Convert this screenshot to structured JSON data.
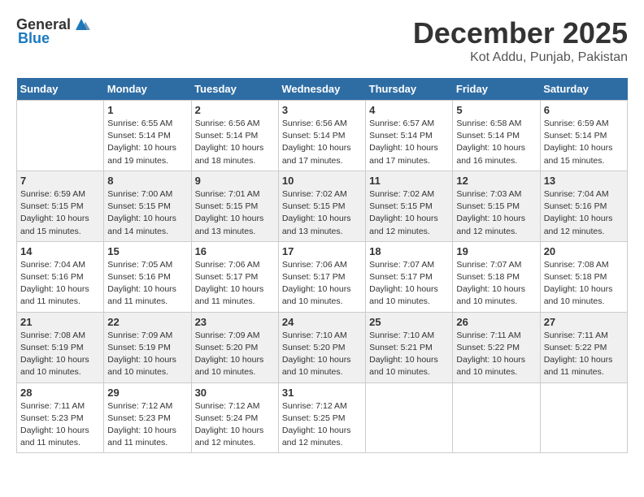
{
  "logo": {
    "general": "General",
    "blue": "Blue"
  },
  "title": {
    "month_year": "December 2025",
    "location": "Kot Addu, Punjab, Pakistan"
  },
  "weekdays": [
    "Sunday",
    "Monday",
    "Tuesday",
    "Wednesday",
    "Thursday",
    "Friday",
    "Saturday"
  ],
  "weeks": [
    [
      {
        "day": "",
        "info": ""
      },
      {
        "day": "1",
        "info": "Sunrise: 6:55 AM\nSunset: 5:14 PM\nDaylight: 10 hours\nand 19 minutes."
      },
      {
        "day": "2",
        "info": "Sunrise: 6:56 AM\nSunset: 5:14 PM\nDaylight: 10 hours\nand 18 minutes."
      },
      {
        "day": "3",
        "info": "Sunrise: 6:56 AM\nSunset: 5:14 PM\nDaylight: 10 hours\nand 17 minutes."
      },
      {
        "day": "4",
        "info": "Sunrise: 6:57 AM\nSunset: 5:14 PM\nDaylight: 10 hours\nand 17 minutes."
      },
      {
        "day": "5",
        "info": "Sunrise: 6:58 AM\nSunset: 5:14 PM\nDaylight: 10 hours\nand 16 minutes."
      },
      {
        "day": "6",
        "info": "Sunrise: 6:59 AM\nSunset: 5:14 PM\nDaylight: 10 hours\nand 15 minutes."
      }
    ],
    [
      {
        "day": "7",
        "info": "Sunrise: 6:59 AM\nSunset: 5:15 PM\nDaylight: 10 hours\nand 15 minutes."
      },
      {
        "day": "8",
        "info": "Sunrise: 7:00 AM\nSunset: 5:15 PM\nDaylight: 10 hours\nand 14 minutes."
      },
      {
        "day": "9",
        "info": "Sunrise: 7:01 AM\nSunset: 5:15 PM\nDaylight: 10 hours\nand 13 minutes."
      },
      {
        "day": "10",
        "info": "Sunrise: 7:02 AM\nSunset: 5:15 PM\nDaylight: 10 hours\nand 13 minutes."
      },
      {
        "day": "11",
        "info": "Sunrise: 7:02 AM\nSunset: 5:15 PM\nDaylight: 10 hours\nand 12 minutes."
      },
      {
        "day": "12",
        "info": "Sunrise: 7:03 AM\nSunset: 5:15 PM\nDaylight: 10 hours\nand 12 minutes."
      },
      {
        "day": "13",
        "info": "Sunrise: 7:04 AM\nSunset: 5:16 PM\nDaylight: 10 hours\nand 12 minutes."
      }
    ],
    [
      {
        "day": "14",
        "info": "Sunrise: 7:04 AM\nSunset: 5:16 PM\nDaylight: 10 hours\nand 11 minutes."
      },
      {
        "day": "15",
        "info": "Sunrise: 7:05 AM\nSunset: 5:16 PM\nDaylight: 10 hours\nand 11 minutes."
      },
      {
        "day": "16",
        "info": "Sunrise: 7:06 AM\nSunset: 5:17 PM\nDaylight: 10 hours\nand 11 minutes."
      },
      {
        "day": "17",
        "info": "Sunrise: 7:06 AM\nSunset: 5:17 PM\nDaylight: 10 hours\nand 10 minutes."
      },
      {
        "day": "18",
        "info": "Sunrise: 7:07 AM\nSunset: 5:17 PM\nDaylight: 10 hours\nand 10 minutes."
      },
      {
        "day": "19",
        "info": "Sunrise: 7:07 AM\nSunset: 5:18 PM\nDaylight: 10 hours\nand 10 minutes."
      },
      {
        "day": "20",
        "info": "Sunrise: 7:08 AM\nSunset: 5:18 PM\nDaylight: 10 hours\nand 10 minutes."
      }
    ],
    [
      {
        "day": "21",
        "info": "Sunrise: 7:08 AM\nSunset: 5:19 PM\nDaylight: 10 hours\nand 10 minutes."
      },
      {
        "day": "22",
        "info": "Sunrise: 7:09 AM\nSunset: 5:19 PM\nDaylight: 10 hours\nand 10 minutes."
      },
      {
        "day": "23",
        "info": "Sunrise: 7:09 AM\nSunset: 5:20 PM\nDaylight: 10 hours\nand 10 minutes."
      },
      {
        "day": "24",
        "info": "Sunrise: 7:10 AM\nSunset: 5:20 PM\nDaylight: 10 hours\nand 10 minutes."
      },
      {
        "day": "25",
        "info": "Sunrise: 7:10 AM\nSunset: 5:21 PM\nDaylight: 10 hours\nand 10 minutes."
      },
      {
        "day": "26",
        "info": "Sunrise: 7:11 AM\nSunset: 5:22 PM\nDaylight: 10 hours\nand 10 minutes."
      },
      {
        "day": "27",
        "info": "Sunrise: 7:11 AM\nSunset: 5:22 PM\nDaylight: 10 hours\nand 11 minutes."
      }
    ],
    [
      {
        "day": "28",
        "info": "Sunrise: 7:11 AM\nSunset: 5:23 PM\nDaylight: 10 hours\nand 11 minutes."
      },
      {
        "day": "29",
        "info": "Sunrise: 7:12 AM\nSunset: 5:23 PM\nDaylight: 10 hours\nand 11 minutes."
      },
      {
        "day": "30",
        "info": "Sunrise: 7:12 AM\nSunset: 5:24 PM\nDaylight: 10 hours\nand 12 minutes."
      },
      {
        "day": "31",
        "info": "Sunrise: 7:12 AM\nSunset: 5:25 PM\nDaylight: 10 hours\nand 12 minutes."
      },
      {
        "day": "",
        "info": ""
      },
      {
        "day": "",
        "info": ""
      },
      {
        "day": "",
        "info": ""
      }
    ]
  ]
}
